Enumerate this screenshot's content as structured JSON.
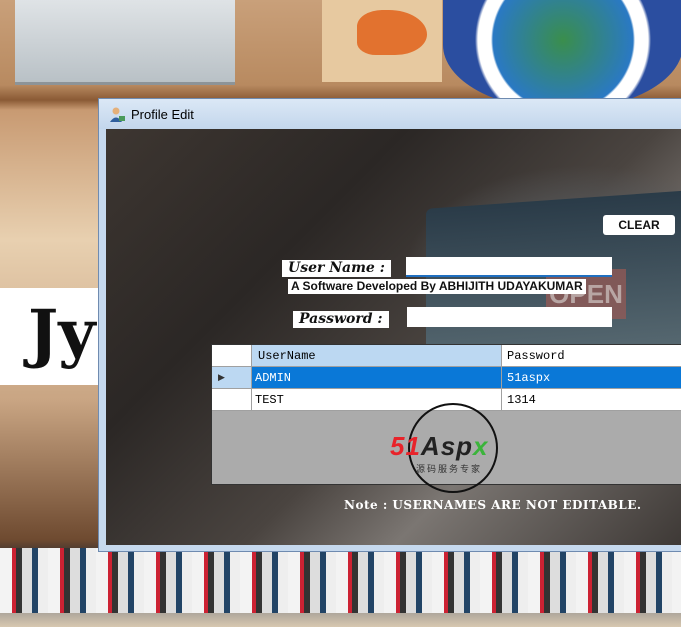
{
  "background": {
    "poster_text": "Jy"
  },
  "window": {
    "title": "Profile Edit",
    "icon": "user-edit-icon",
    "username_label": "User Name :",
    "username_value": "",
    "password_label": "Password :",
    "password_value": "",
    "developer_credit": "A Software Developed By ABHIJITH UDAYAKUMAR",
    "clear_button": "CLEAR",
    "sign_text": "OPEN",
    "grid": {
      "columns": [
        "UserName",
        "Password"
      ],
      "rows": [
        {
          "username": "ADMIN",
          "password": "51aspx",
          "selected": true
        },
        {
          "username": "TEST",
          "password": "1314",
          "selected": false
        }
      ],
      "watermark": {
        "brand_red": "51",
        "brand_dark": "Asp",
        "brand_green": "x",
        "subtitle": "源码服务专家"
      }
    },
    "note": "Note : USERNAMES ARE NOT EDITABLE."
  },
  "colors": {
    "selection": "#0a78d7",
    "header": "#bcd8f2",
    "title_bar": "#c6d9ee"
  }
}
